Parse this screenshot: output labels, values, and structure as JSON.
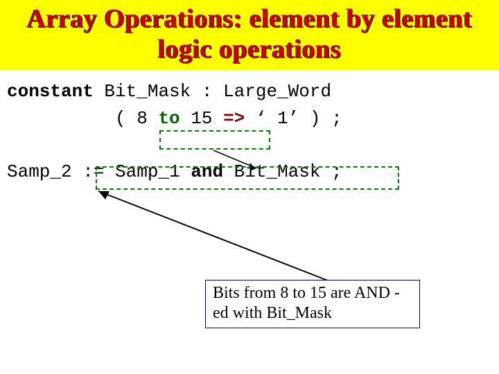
{
  "title": "Array Operations: element by element logic operations",
  "code": {
    "kw_constant": "constant",
    "ident1": " Bit_Mask : Large_Word",
    "indent2": "          ( 8 ",
    "kw_to": "to",
    "after_to": " 15 ",
    "kw_fatarrow": "=>",
    "after_fat": " ‘ 1’ ) ;",
    "line3_pre": "Samp_2 := Samp_1 ",
    "kw_and": "and",
    "line3_post": " Bit_Mask ;"
  },
  "annotation": "Bits from 8 to 15 are AND -ed with Bit_Mask"
}
